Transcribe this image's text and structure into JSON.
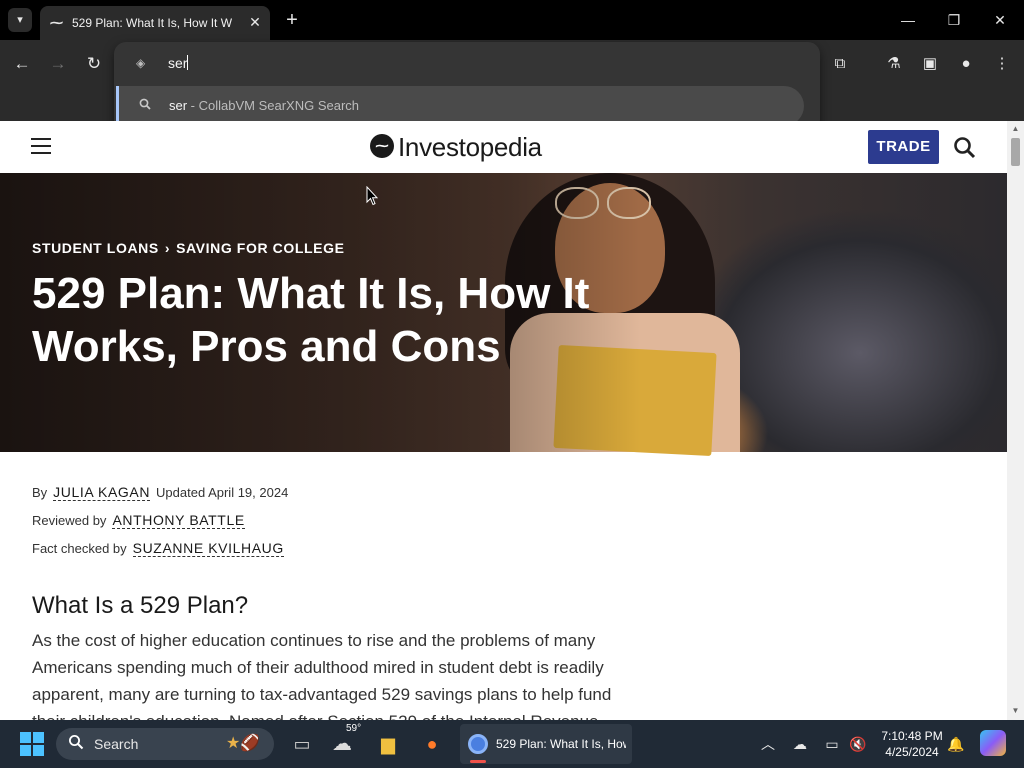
{
  "browser": {
    "tab": {
      "title": "529 Plan: What It Is, How It W"
    },
    "omnibox": {
      "typed": "ser",
      "suggestion": {
        "query": "ser",
        "separator": " - ",
        "engine": "CollabVM SearXNG Search"
      }
    }
  },
  "site": {
    "logo_text": "Investopedia",
    "trade_label": "TRADE"
  },
  "article": {
    "breadcrumb": [
      "STUDENT LOANS",
      "SAVING FOR COLLEGE"
    ],
    "breadcrumb_separator": "›",
    "title": "529 Plan: What It Is, How It Works, Pros and Cons",
    "byline": {
      "by_label": "By",
      "author": "JULIA KAGAN",
      "updated": "Updated April 19, 2024",
      "reviewed_label": "Reviewed by",
      "reviewer": "ANTHONY BATTLE",
      "factcheck_label": "Fact checked by",
      "factchecker": "SUZANNE KVILHAUG"
    },
    "section_heading": "What Is a 529 Plan?",
    "body": "As the cost of higher education continues to rise and the problems of many Americans spending much of their adulthood mired in student debt is readily apparent, many are turning to tax-advantaged 529 savings plans to help fund their children's education. Named after Section 529 of the Internal Revenue"
  },
  "taskbar": {
    "search_label": "Search",
    "weather_temp": "59°",
    "active_app_label": "529 Plan: What It Is, How",
    "clock_time": "7:10:48 PM",
    "clock_date": "4/25/2024"
  },
  "colors": {
    "trade_button": "#2c3b8f",
    "omnibox_bg": "#353535",
    "toolbar_bg": "#2b2b2b",
    "taskbar_bg": "#202a36",
    "suggestion_accent": "#a8c7fa"
  }
}
